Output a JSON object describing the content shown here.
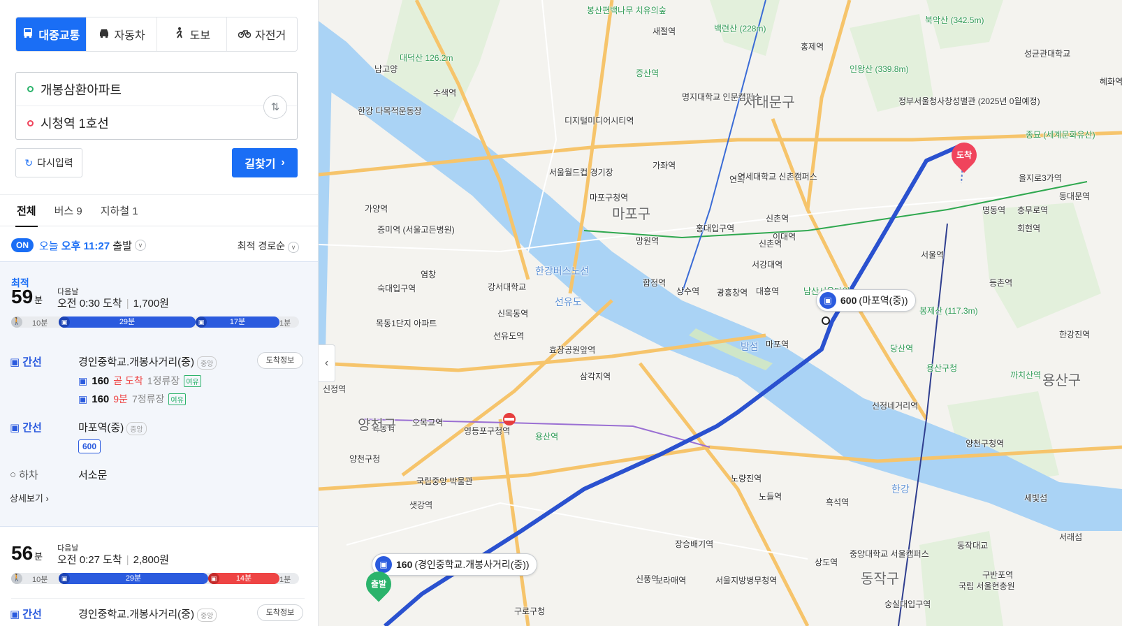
{
  "modes": {
    "transit": "대중교통",
    "car": "자동차",
    "walk": "도보",
    "bike": "자전거"
  },
  "search": {
    "origin": "개봉삼환아파트",
    "destination": "시청역 1호선",
    "reset": "다시입력",
    "find": "길찾기"
  },
  "tabs": {
    "all": "전체",
    "bus": "버스 9",
    "subway": "지하철 1"
  },
  "timebar": {
    "on": "ON",
    "today": "오늘",
    "time": "오후 11:27",
    "depart": "출발",
    "sort": "최적 경로순"
  },
  "route1": {
    "badge": "최적",
    "minutes": "59",
    "unit": "분",
    "next_day": "다음날",
    "arrival": "오전 0:30 도착",
    "fare": "1,700원",
    "bar": {
      "walk1": "10분",
      "bus1": "29분",
      "bus2": "17분",
      "walk2": "1분"
    },
    "steps": [
      {
        "type": "간선",
        "stop": "경인중학교.개봉사거리(중)",
        "dir": "중앙",
        "info": "도착정보"
      },
      {
        "type": "간선",
        "stop": "마포역(중)",
        "dir": "중앙"
      },
      {
        "type": "하차",
        "stop": "서소문"
      }
    ],
    "arrivals": [
      {
        "line": "160",
        "eta": "곧 도착",
        "stops": "1정류장",
        "crowd": "여유"
      },
      {
        "line": "160",
        "eta": "9분",
        "stops": "7정류장",
        "crowd": "여유"
      }
    ],
    "bus600": "600",
    "more": "상세보기"
  },
  "route2": {
    "minutes": "56",
    "unit": "분",
    "next_day": "다음날",
    "arrival": "오전 0:27 도착",
    "fare": "2,800원",
    "bar": {
      "walk1": "10분",
      "bus1": "29분",
      "sub": "14분",
      "walk2": "1분"
    },
    "step": {
      "type": "간선",
      "stop": "경인중학교.개봉사거리(중)",
      "dir": "중앙",
      "info": "도착정보"
    }
  },
  "map": {
    "callout600": {
      "num": "600",
      "name": "(마포역(중))"
    },
    "callout160": {
      "num": "160",
      "name": "(경인중학교.개봉사거리(중))"
    },
    "start": "출발",
    "end": "도착",
    "districts": [
      "마포구",
      "용산구",
      "동작구",
      "양천구",
      "서대문구"
    ],
    "river_labels": [
      "선유도",
      "밤섬",
      "한강",
      "한강버스노선"
    ],
    "places": [
      "봉산편백나무 치유의숲",
      "새절역",
      "백련산 (228m)",
      "북악산 (342.5m)",
      "성균관대학교",
      "홍제역",
      "대덕산 126.2m",
      "남고양",
      "증산역",
      "인왕산 (339.8m)",
      "정부서울청사창성별관 (2025년 0월예정)",
      "수색역",
      "명지대학교 인문캠퍼스",
      "종묘 (세계문화유산)",
      "디지털미디어시티역",
      "한강 다목적운동장",
      "가좌역",
      "연희",
      "연세대학교 신촌캠퍼스",
      "을지로3가역",
      "서울월드컵 경기장",
      "마포구청역",
      "신촌역",
      "동대문역",
      "가양역",
      "이대역",
      "명동역",
      "충무로역",
      "증미역 (서울고든병원)",
      "망원역",
      "홍대입구역",
      "신촌역",
      "회현역",
      "서울역",
      "서강대역",
      "합정역",
      "상수역",
      "광흥창역",
      "대흥역",
      "남산서울타워",
      "등촌역",
      "염창",
      "강서대학교",
      "숙대입구역",
      "봉제산 (117.3m)",
      "신목동역",
      "목동1단지 아파트",
      "선유도역",
      "마포역",
      "효창공원앞역",
      "당산역",
      "삼각지역",
      "용산구청",
      "까치산역",
      "신정역",
      "목동역",
      "오목교역",
      "영등포구청역",
      "용산역",
      "신정네거리역",
      "양천구청",
      "국립중앙 박물관",
      "양천구청역",
      "샛강역",
      "노량진역",
      "노들역",
      "흑석역",
      "세빛섬",
      "서래섬",
      "동작대교",
      "중앙대학교 서울캠퍼스",
      "장승배기역",
      "상도역",
      "서울지방병무청역",
      "신풍역",
      "보라매역",
      "구로구청",
      "숭실대입구역",
      "국립 서울현충원",
      "구반포역",
      "혜화역",
      "한강진역"
    ]
  }
}
